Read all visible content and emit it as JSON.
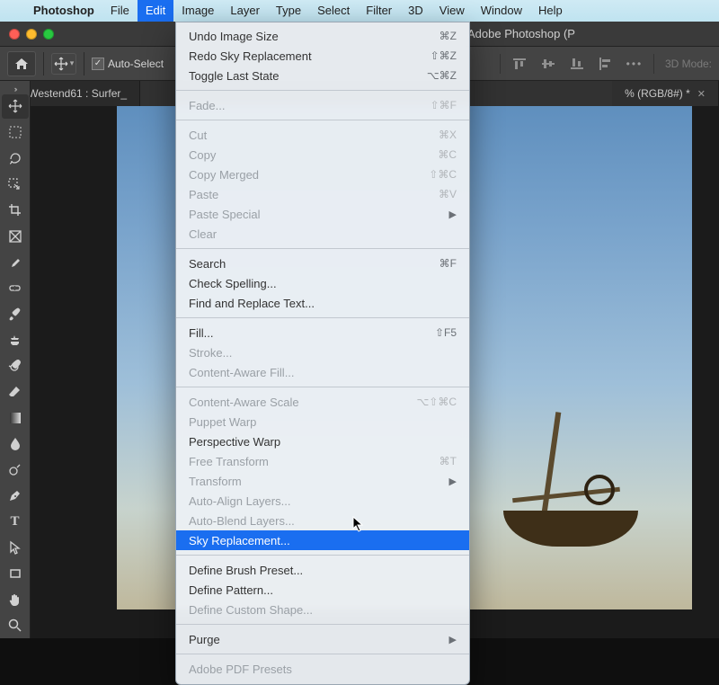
{
  "menubar": {
    "app": "Photoshop",
    "items": [
      "File",
      "Edit",
      "Image",
      "Layer",
      "Type",
      "Select",
      "Filter",
      "3D",
      "View",
      "Window",
      "Help"
    ],
    "active": "Edit"
  },
  "window": {
    "title": "Adobe Photoshop (P"
  },
  "options": {
    "auto_select_label": "Auto-Select",
    "mode_label": "3D Mode:"
  },
  "tabs": {
    "left": "Westend61 : Surfer_",
    "right": "% (RGB/8#) *"
  },
  "tools": [
    {
      "name": "move-tool",
      "selected": true
    },
    {
      "name": "marquee-tool"
    },
    {
      "name": "lasso-tool"
    },
    {
      "name": "object-select-tool"
    },
    {
      "name": "crop-tool"
    },
    {
      "name": "frame-tool"
    },
    {
      "name": "eyedropper-tool"
    },
    {
      "name": "healing-brush-tool"
    },
    {
      "name": "brush-tool"
    },
    {
      "name": "clone-stamp-tool"
    },
    {
      "name": "history-brush-tool"
    },
    {
      "name": "eraser-tool"
    },
    {
      "name": "gradient-tool"
    },
    {
      "name": "blur-tool"
    },
    {
      "name": "dodge-tool"
    },
    {
      "name": "pen-tool"
    },
    {
      "name": "type-tool"
    },
    {
      "name": "path-select-tool"
    },
    {
      "name": "rectangle-tool"
    },
    {
      "name": "hand-tool"
    },
    {
      "name": "zoom-tool"
    }
  ],
  "edit_menu": [
    {
      "label": "Undo Image Size",
      "shortcut": "⌘Z"
    },
    {
      "label": "Redo Sky Replacement",
      "shortcut": "⇧⌘Z"
    },
    {
      "label": "Toggle Last State",
      "shortcut": "⌥⌘Z"
    },
    {
      "sep": true
    },
    {
      "label": "Fade...",
      "shortcut": "⇧⌘F",
      "disabled": true
    },
    {
      "sep": true
    },
    {
      "label": "Cut",
      "shortcut": "⌘X",
      "disabled": true
    },
    {
      "label": "Copy",
      "shortcut": "⌘C",
      "disabled": true
    },
    {
      "label": "Copy Merged",
      "shortcut": "⇧⌘C",
      "disabled": true
    },
    {
      "label": "Paste",
      "shortcut": "⌘V",
      "disabled": true
    },
    {
      "label": "Paste Special",
      "submenu": true,
      "disabled": true
    },
    {
      "label": "Clear",
      "disabled": true
    },
    {
      "sep": true
    },
    {
      "label": "Search",
      "shortcut": "⌘F"
    },
    {
      "label": "Check Spelling..."
    },
    {
      "label": "Find and Replace Text..."
    },
    {
      "sep": true
    },
    {
      "label": "Fill...",
      "shortcut": "⇧F5"
    },
    {
      "label": "Stroke...",
      "disabled": true
    },
    {
      "label": "Content-Aware Fill...",
      "disabled": true
    },
    {
      "sep": true
    },
    {
      "label": "Content-Aware Scale",
      "shortcut": "⌥⇧⌘C",
      "disabled": true
    },
    {
      "label": "Puppet Warp",
      "disabled": true
    },
    {
      "label": "Perspective Warp"
    },
    {
      "label": "Free Transform",
      "shortcut": "⌘T",
      "disabled": true
    },
    {
      "label": "Transform",
      "submenu": true,
      "disabled": true
    },
    {
      "label": "Auto-Align Layers...",
      "disabled": true
    },
    {
      "label": "Auto-Blend Layers...",
      "disabled": true
    },
    {
      "label": "Sky Replacement...",
      "highlight": true
    },
    {
      "sep": true
    },
    {
      "label": "Define Brush Preset..."
    },
    {
      "label": "Define Pattern..."
    },
    {
      "label": "Define Custom Shape...",
      "disabled": true
    },
    {
      "sep": true
    },
    {
      "label": "Purge",
      "submenu": true
    },
    {
      "sep": true
    },
    {
      "label": "Adobe PDF Presets",
      "disabled": true
    }
  ]
}
